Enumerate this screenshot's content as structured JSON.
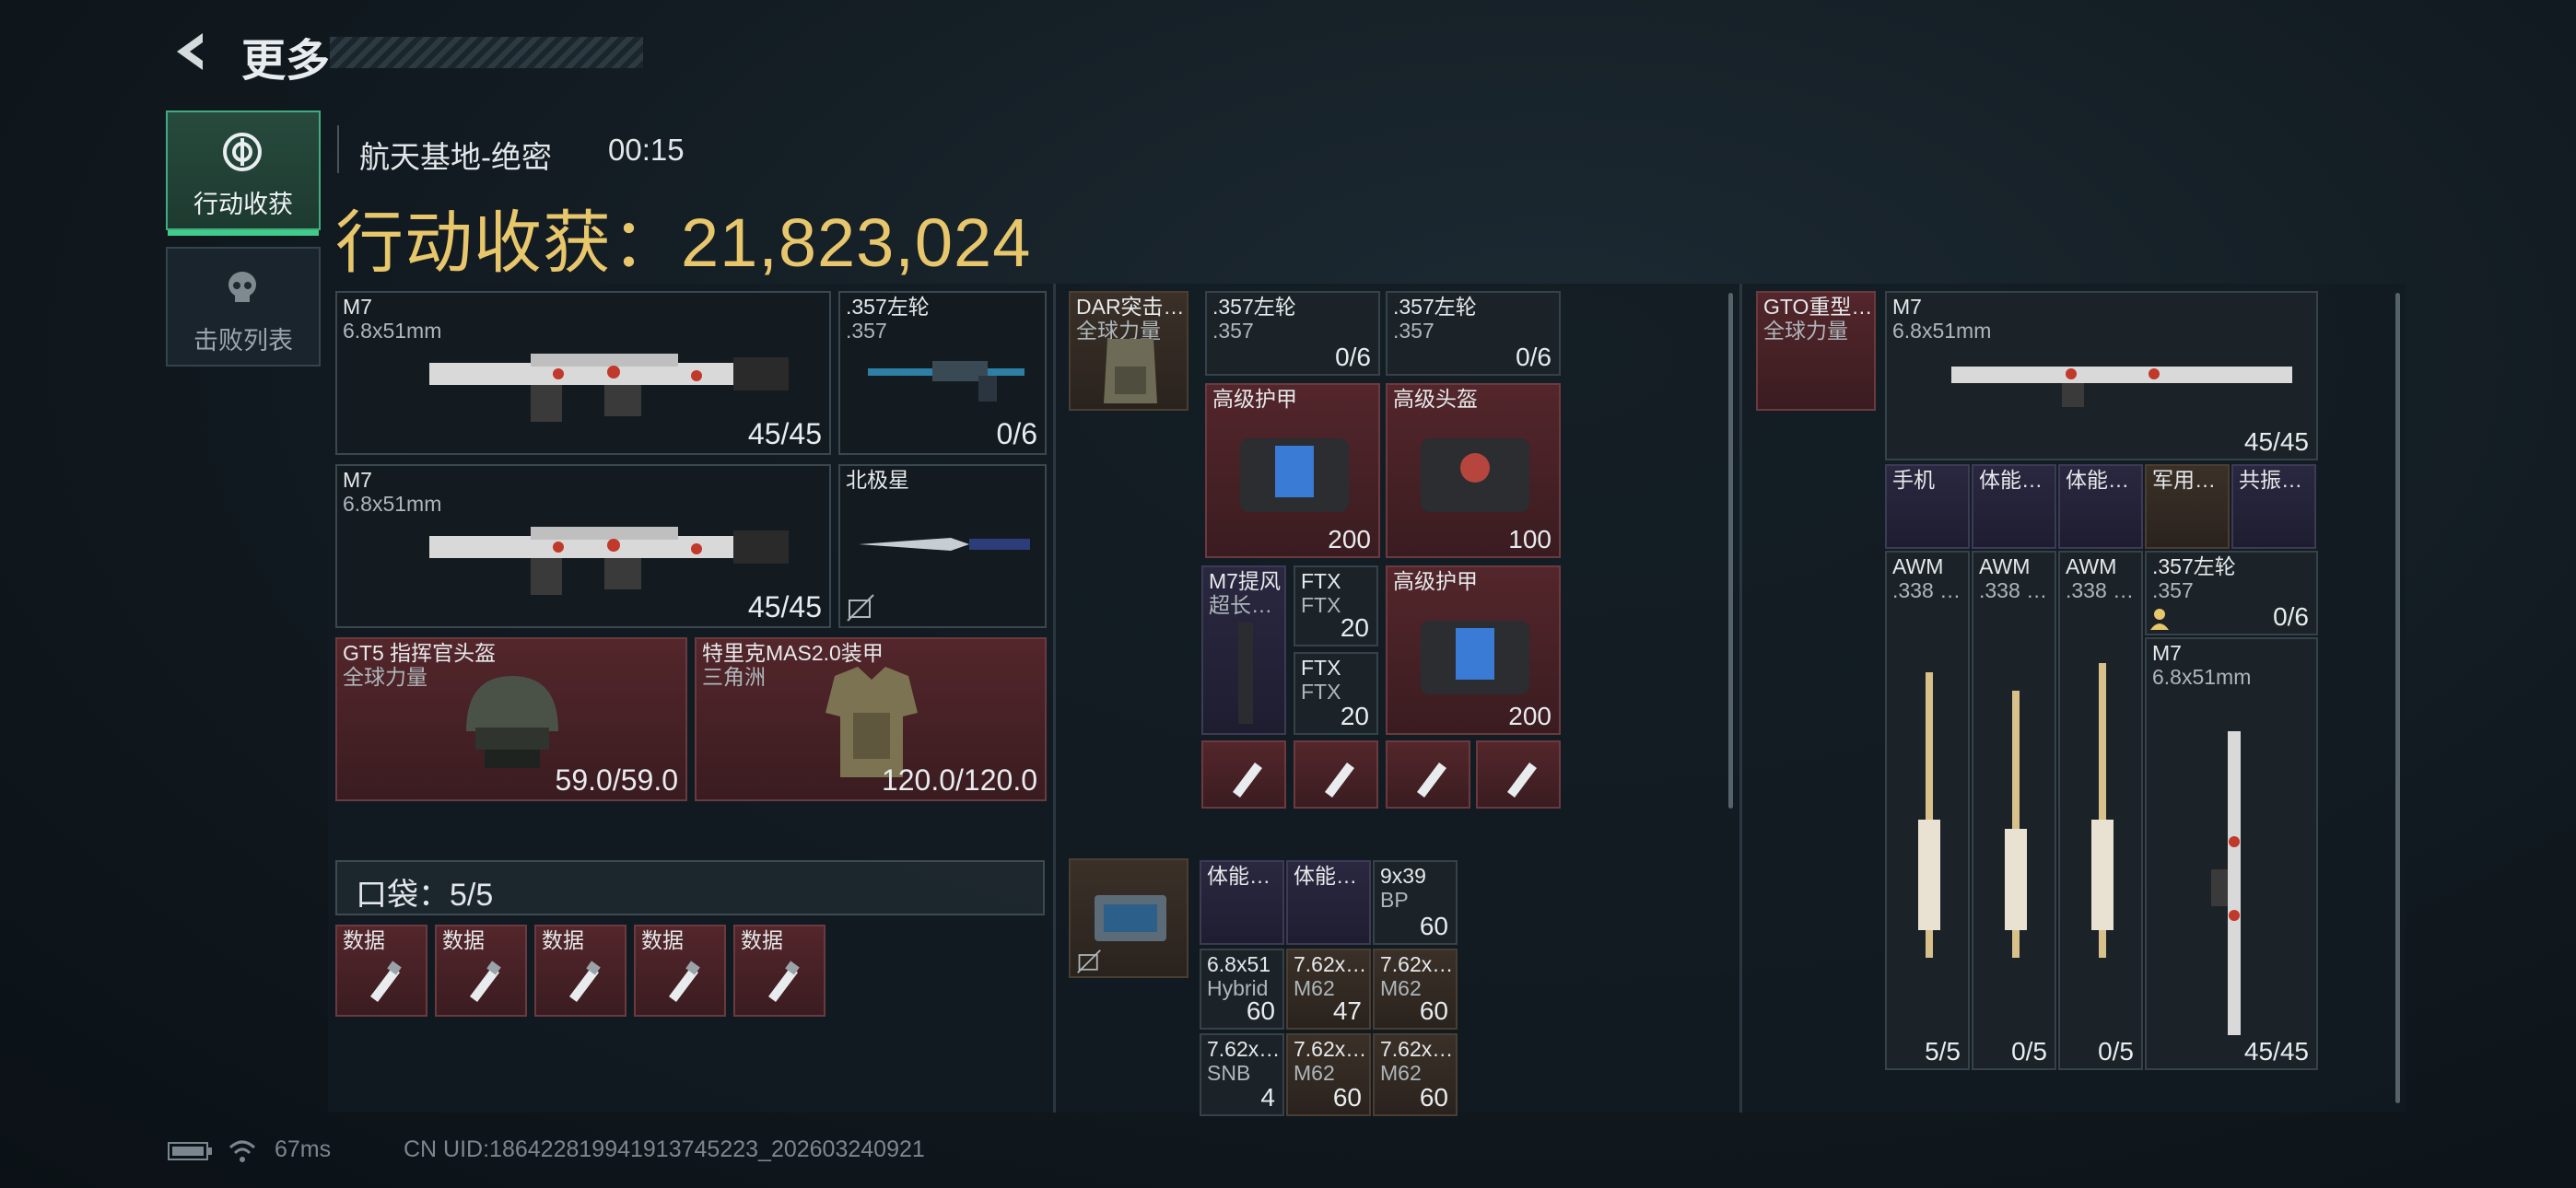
{
  "header": {
    "title": "更多"
  },
  "nav": {
    "tabs": [
      {
        "label": "行动收获",
        "active": true
      },
      {
        "label": "击败列表",
        "active": false
      }
    ]
  },
  "match": {
    "map": "航天基地-绝密",
    "time": "00:15"
  },
  "loot": {
    "label": "行动收获：21,823,024"
  },
  "equipment": {
    "primary1": {
      "name": "M7",
      "ammo": "6.8x51mm",
      "count": "45/45"
    },
    "secondary": {
      "name": ".357左轮",
      "ammo": ".357",
      "count": "0/6"
    },
    "primary2": {
      "name": "M7",
      "ammo": "6.8x51mm",
      "count": "45/45"
    },
    "melee": {
      "name": "北极星"
    },
    "helmet": {
      "name": "GT5 指挥官头盔",
      "sub": "全球力量",
      "count": "59.0/59.0"
    },
    "armor": {
      "name": "特里克MAS2.0装甲",
      "sub": "三角洲",
      "count": "120.0/120.0"
    }
  },
  "pocket": {
    "label": "口袋：5/5",
    "items": [
      {
        "name": "数据"
      },
      {
        "name": "数据"
      },
      {
        "name": "数据"
      },
      {
        "name": "数据"
      },
      {
        "name": "数据"
      }
    ]
  },
  "chest_rig": {
    "rig": {
      "name": "DAR突击…",
      "sub": "全球力量"
    },
    "revolver1": {
      "name": ".357左轮",
      "ammo": ".357",
      "count": "0/6"
    },
    "revolver2": {
      "name": ".357左轮",
      "ammo": ".357",
      "count": "0/6"
    },
    "armor1": {
      "name": "高级护甲",
      "count": "200"
    },
    "helmet1": {
      "name": "高级头盔",
      "count": "100"
    },
    "muzzle": {
      "name": "M7提风",
      "sub": "超长…"
    },
    "ftx1": {
      "name": "FTX",
      "sub": "FTX",
      "count": "20"
    },
    "ftx2": {
      "name": "FTX",
      "sub": "FTX",
      "count": "20"
    },
    "armor2": {
      "name": "高级护甲",
      "count": "200"
    }
  },
  "backpack": {
    "items": [
      {
        "name": "体能…",
        "count": ""
      },
      {
        "name": "体能…",
        "count": ""
      },
      {
        "name": "9x39",
        "sub": "BP",
        "count": "60"
      },
      {
        "name": "6.8x51",
        "sub": "Hybrid",
        "count": "60"
      },
      {
        "name": "7.62x…",
        "sub": "M62",
        "count": "47"
      },
      {
        "name": "7.62x…",
        "sub": "M62",
        "count": "60"
      },
      {
        "name": "7.62x…",
        "sub": "SNB",
        "count": "4"
      },
      {
        "name": "7.62x…",
        "sub": "M62",
        "count": "60"
      },
      {
        "name": "7.62x…",
        "sub": "M62",
        "count": "60"
      }
    ]
  },
  "safe_box": {
    "rig": {
      "name": "GTO重型…",
      "sub": "全球力量"
    },
    "m7": {
      "name": "M7",
      "ammo": "6.8x51mm",
      "count": "45/45"
    },
    "small": [
      {
        "name": "手机"
      },
      {
        "name": "体能…"
      },
      {
        "name": "体能…"
      },
      {
        "name": "军用…"
      },
      {
        "name": "共振…"
      }
    ],
    "awm": [
      {
        "name": "AWM",
        "ammo": ".338 …",
        "count": "5/5"
      },
      {
        "name": "AWM",
        "ammo": ".338 …",
        "count": "0/5"
      },
      {
        "name": "AWM",
        "ammo": ".338 …",
        "count": "0/5"
      }
    ],
    "revolver": {
      "name": ".357左轮",
      "ammo": ".357",
      "count": "0/6"
    },
    "m7b": {
      "name": "M7",
      "ammo": "6.8x51mm",
      "count": "45/45"
    }
  },
  "footer": {
    "ping": "67ms",
    "uid": "CN UID:186422819941913745223_202603240921"
  },
  "colors": {
    "accent_gold": "#e8c66b",
    "accent_green": "#3fcc8c",
    "red_slot": "#53262b"
  }
}
